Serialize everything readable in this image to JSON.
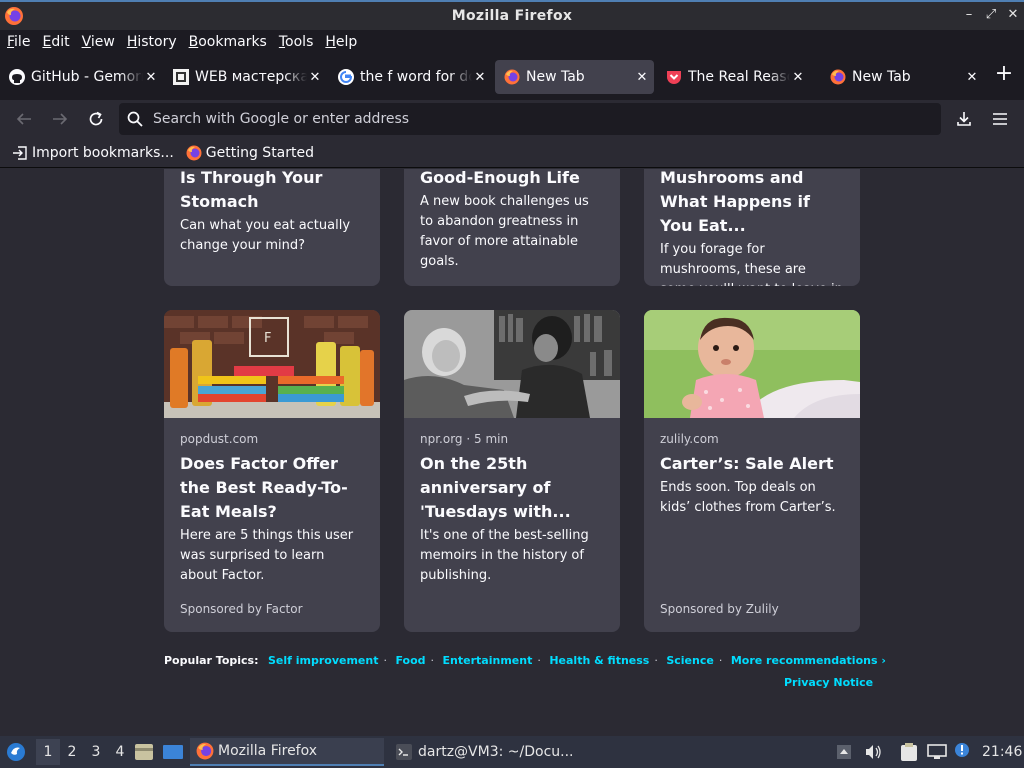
{
  "window": {
    "title": "Mozilla Firefox"
  },
  "menu": [
    "File",
    "Edit",
    "View",
    "History",
    "Bookmarks",
    "Tools",
    "Help"
  ],
  "tabs": [
    {
      "label": "GitHub - Gemorro",
      "icon": "github-icon",
      "active": false
    },
    {
      "label": "WEB мастерская",
      "icon": "web-icon",
      "active": false
    },
    {
      "label": "the f word for dog",
      "icon": "google-icon",
      "active": false
    },
    {
      "label": "New Tab",
      "icon": "firefox-icon",
      "active": true
    },
    {
      "label": "The Real Reason",
      "icon": "pocket-icon",
      "active": false
    },
    {
      "label": "New Tab",
      "icon": "firefox-icon",
      "active": false
    }
  ],
  "urlbar": {
    "placeholder": "Search with Google or enter address"
  },
  "bookmarks": [
    {
      "label": "Import bookmarks...",
      "icon": "import-icon"
    },
    {
      "label": "Getting Started",
      "icon": "firefox-icon"
    }
  ],
  "top_cards": [
    {
      "headline": "Is Through Your Stomach",
      "excerpt": "Can what you eat actually change your mind?"
    },
    {
      "headline": "Good-Enough Life",
      "excerpt": "A new book challenges us to abandon greatness in favor of more attainable goals."
    },
    {
      "headline": "Mushrooms and What Happens if You Eat...",
      "excerpt": "If you forage for mushrooms, these are some you'll want to leave in the..."
    }
  ],
  "cards": [
    {
      "source": "popdust.com",
      "headline": "Does Factor Offer the Best Ready-To-Eat Meals?",
      "excerpt": "Here are 5 things this user was surprised to learn about Factor.",
      "sponsor": "Sponsored by Factor"
    },
    {
      "source": "npr.org · 5 min",
      "headline": "On the 25th anniversary of 'Tuesdays with...",
      "excerpt": "It's one of the best-selling memoirs in the history of publishing.",
      "sponsor": ""
    },
    {
      "source": "zulily.com",
      "headline": "Carter’s: Sale Alert",
      "excerpt": "Ends soon. Top deals on kids’ clothes from Carter’s.",
      "sponsor": "Sponsored by Zulily"
    }
  ],
  "topics": {
    "label": "Popular Topics:",
    "links": [
      "Self improvement",
      "Food",
      "Entertainment",
      "Health & fitness",
      "Science",
      "More recommendations ›"
    ],
    "privacy": "Privacy Notice"
  },
  "taskbar": {
    "workspaces": [
      "1",
      "2",
      "3",
      "4"
    ],
    "apps": [
      {
        "label": "Mozilla Firefox",
        "icon": "firefox-icon"
      },
      {
        "label": "dartz@VM3: ~/Docu...",
        "icon": "terminal-icon"
      }
    ],
    "clock": "21:46"
  },
  "colors": {
    "accent": "#00ddff",
    "bg": "#2b2a33",
    "card": "#42414d"
  }
}
